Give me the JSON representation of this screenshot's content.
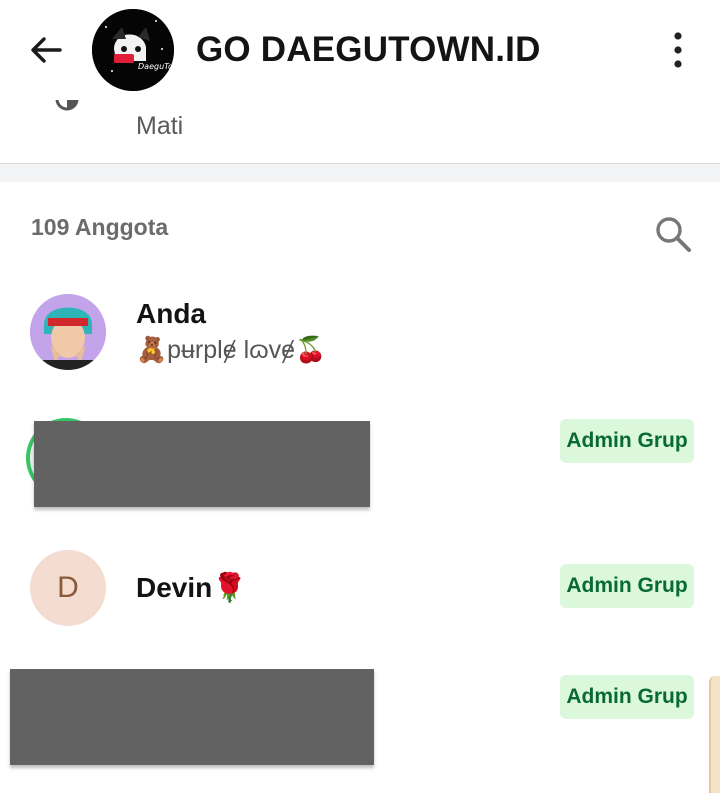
{
  "header": {
    "title": "GO DAEGUTOWN.ID",
    "group_avatar_label": "DaeguTown.id"
  },
  "disappearing": {
    "sub_text": "Mati"
  },
  "members": {
    "count_label": "109 Anggota",
    "items": [
      {
        "name": "Anda",
        "status": "🧸pʉrplɇ lɷvɇ🍒"
      },
      {
        "role_badge": "Admin Grup"
      },
      {
        "name": "Devin🌹",
        "avatar_initial": "D",
        "role_badge": "Admin Grup"
      },
      {
        "role_badge": "Admin Grup"
      }
    ]
  },
  "colors": {
    "badge_bg": "#dcf8dc",
    "badge_text": "#0a6a33",
    "redaction": "#626262",
    "online_ring": "#39c463"
  }
}
